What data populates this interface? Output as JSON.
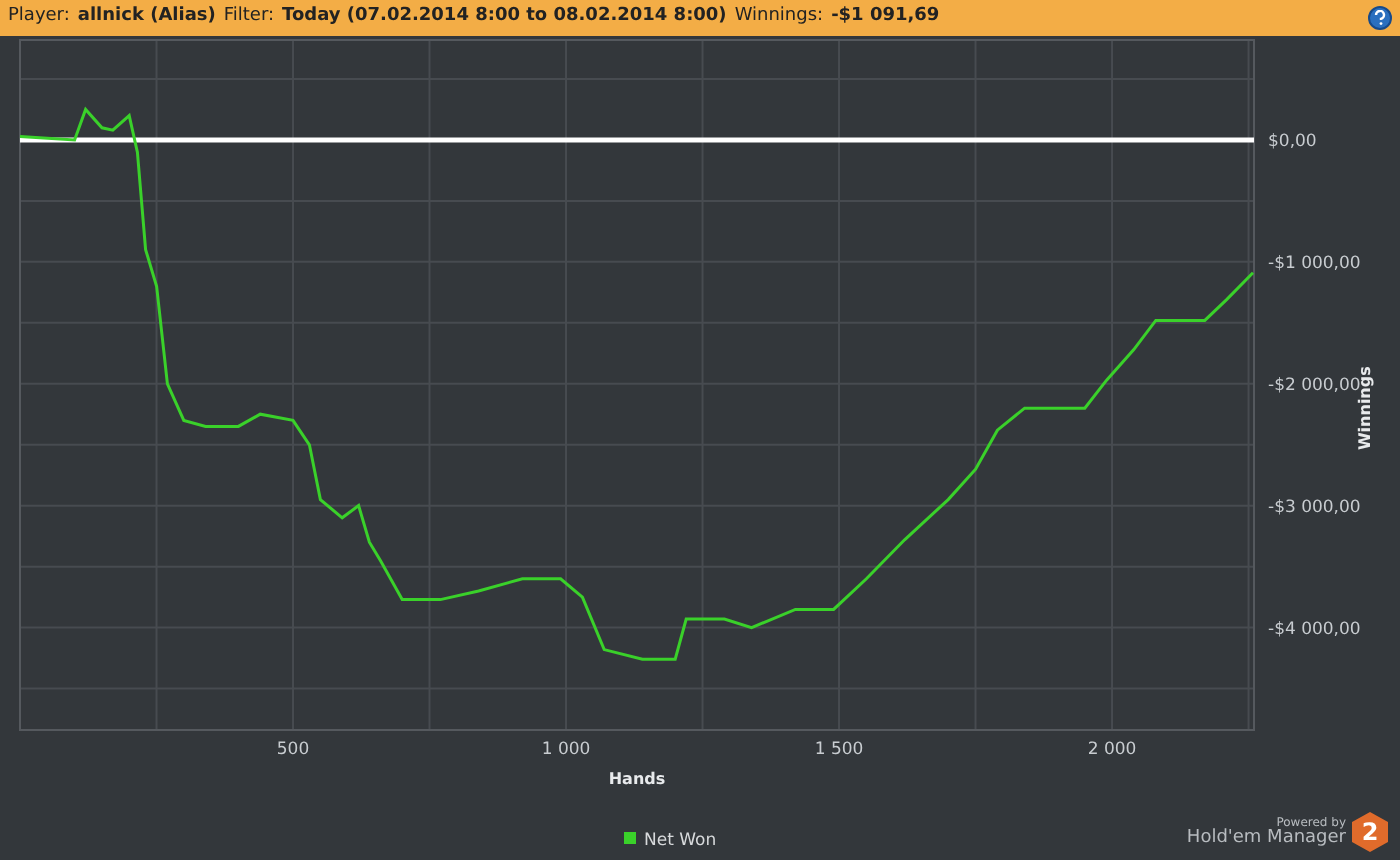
{
  "header": {
    "player_label": "Player:",
    "player": "allnick (Alias)",
    "filter_label": "Filter:",
    "filter": "Today (07.02.2014 8:00 to 08.02.2014 8:00)",
    "winnings_label": "Winnings:",
    "winnings": "-$1 091,69"
  },
  "chart": {
    "chart_data": {
      "type": "line",
      "grid": true,
      "xlabel": "Hands",
      "ylabel": "Winnings",
      "xlim": [
        0,
        2260
      ],
      "ylim": [
        -4840,
        820
      ],
      "xticks": [
        {
          "value": 500,
          "label": "500"
        },
        {
          "value": 1000,
          "label": "1 000"
        },
        {
          "value": 1500,
          "label": "1 500"
        },
        {
          "value": 2000,
          "label": "2 000"
        }
      ],
      "yticks": [
        {
          "value": 0,
          "label": "$0,00"
        },
        {
          "value": -1000,
          "label": "-$1 000,00"
        },
        {
          "value": -2000,
          "label": "-$2 000,00"
        },
        {
          "value": -3000,
          "label": "-$3 000,00"
        },
        {
          "value": -4000,
          "label": "-$4 000,00"
        }
      ],
      "x": [
        0,
        100,
        120,
        150,
        170,
        200,
        215,
        230,
        250,
        270,
        300,
        340,
        400,
        440,
        500,
        530,
        550,
        590,
        620,
        640,
        660,
        700,
        770,
        840,
        920,
        990,
        1030,
        1070,
        1140,
        1200,
        1220,
        1290,
        1340,
        1420,
        1490,
        1550,
        1620,
        1700,
        1750,
        1790,
        1840,
        1900,
        1950,
        1990,
        2040,
        2080,
        2130,
        2170,
        2210,
        2258
      ],
      "series": [
        {
          "name": "Net Won",
          "color": "#3ad12a",
          "values": [
            30,
            0,
            250,
            100,
            80,
            200,
            -100,
            -900,
            -1200,
            -2000,
            -2300,
            -2350,
            -2350,
            -2250,
            -2300,
            -2500,
            -2950,
            -3100,
            -3000,
            -3300,
            -3450,
            -3770,
            -3770,
            -3700,
            -3600,
            -3600,
            -3750,
            -4180,
            -4260,
            -4260,
            -3930,
            -3930,
            -4000,
            -3850,
            -3850,
            -3600,
            -3280,
            -2950,
            -2700,
            -2380,
            -2200,
            -2200,
            -2200,
            -1970,
            -1720,
            -1480,
            -1480,
            -1480,
            -1310,
            -1090
          ]
        }
      ]
    }
  },
  "footer": {
    "powered_by": "Powered by",
    "product": "Hold'em Manager",
    "logo_mark": "2"
  }
}
